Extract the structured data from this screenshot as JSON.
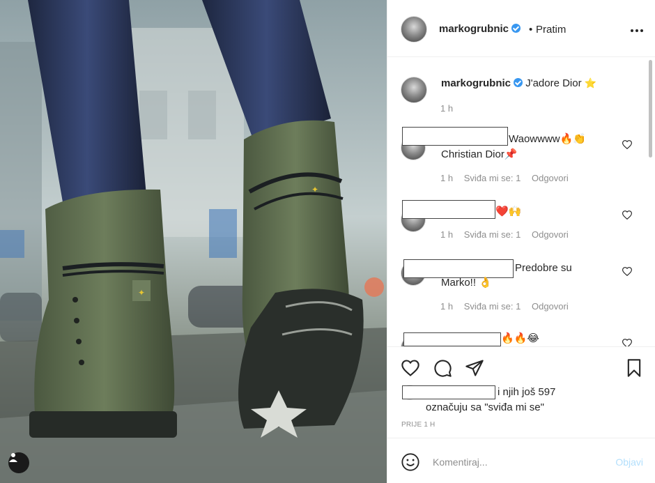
{
  "post": {
    "username": "markogrubnic",
    "verified": true,
    "follow_separator": "•",
    "follow_label": "Pratim",
    "more_icon": "more-horizontal-icon"
  },
  "caption": {
    "username": "markogrubnic",
    "text": "J'adore Dior",
    "emoji": "⭐",
    "time": "1 h"
  },
  "comments": [
    {
      "text": "Waowwww🔥👏",
      "text2": "Christian Dior📌",
      "time": "1 h",
      "likes": "Sviđa mi se: 1",
      "reply": "Odgovori"
    },
    {
      "text": "❤️🙌",
      "text2": "",
      "time": "1 h",
      "likes": "Sviđa mi se: 1",
      "reply": "Odgovori"
    },
    {
      "text": "Predobre su",
      "text2": "Marko!! 👌",
      "time": "1 h",
      "likes": "Sviđa mi se: 1",
      "reply": "Odgovori"
    },
    {
      "text": "🔥🔥😂",
      "text2": "",
      "time": "",
      "likes": "",
      "reply": ""
    }
  ],
  "likes": {
    "line1": "i njih još 597",
    "line2": "označuju sa \"sviđa mi se\""
  },
  "timestamp": "PRIJE 1 H",
  "comment_input": {
    "placeholder": "Komentiraj...",
    "value": ""
  },
  "post_button": "Objavi",
  "colors": {
    "accent": "#3897f0",
    "post_button_disabled": "#b2dffc",
    "secondary_text": "#8e8e8e",
    "boot_green": "#5f6e4f"
  },
  "icons": [
    "heart-icon",
    "comment-icon",
    "share-icon",
    "bookmark-icon",
    "smiley-icon",
    "tag-user-icon"
  ]
}
